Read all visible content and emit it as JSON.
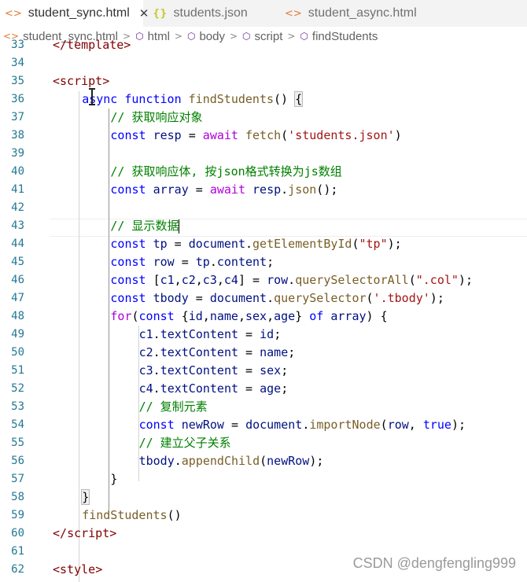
{
  "tabs": [
    {
      "icon": "html-file-icon",
      "label": "student_sync.html",
      "active": true,
      "close": "✕"
    },
    {
      "icon": "json-file-icon",
      "label": "students.json",
      "active": false
    },
    {
      "icon": "html-file-icon",
      "label": "student_async.html",
      "active": false
    }
  ],
  "breadcrumb": [
    "student_sync.html",
    "html",
    "body",
    "script",
    "findStudents"
  ],
  "lines": [
    {
      "n": "33",
      "code": [
        [
          "t-tag",
          "</template>"
        ]
      ]
    },
    {
      "n": "34",
      "code": []
    },
    {
      "n": "35",
      "code": [
        [
          "t-brk",
          "<"
        ],
        [
          "t-tag",
          "script"
        ],
        [
          "t-brk",
          ">"
        ]
      ]
    },
    {
      "n": "36",
      "code": [
        [
          "t-kw",
          "async"
        ],
        [
          "t-pun",
          " "
        ],
        [
          "t-kw",
          "function"
        ],
        [
          "t-pun",
          " "
        ],
        [
          "t-fn",
          "findStudents"
        ],
        [
          "t-pun",
          "() "
        ],
        [
          "bracket-hl",
          "{"
        ]
      ]
    },
    {
      "n": "37",
      "code": [
        [
          "t-cmt",
          "// 获取响应对象"
        ]
      ]
    },
    {
      "n": "38",
      "code": [
        [
          "t-kw",
          "const"
        ],
        [
          "t-pun",
          " "
        ],
        [
          "t-var",
          "resp"
        ],
        [
          "t-pun",
          " = "
        ],
        [
          "t-ctl",
          "await"
        ],
        [
          "t-pun",
          " "
        ],
        [
          "t-fn",
          "fetch"
        ],
        [
          "t-pun",
          "("
        ],
        [
          "t-str",
          "'students.json'"
        ],
        [
          "t-pun",
          ")"
        ]
      ]
    },
    {
      "n": "39",
      "code": []
    },
    {
      "n": "40",
      "code": [
        [
          "t-cmt",
          "// 获取响应体, 按json格式转换为js数组"
        ]
      ]
    },
    {
      "n": "41",
      "code": [
        [
          "t-kw",
          "const"
        ],
        [
          "t-pun",
          " "
        ],
        [
          "t-var",
          "array"
        ],
        [
          "t-pun",
          " = "
        ],
        [
          "t-ctl",
          "await"
        ],
        [
          "t-pun",
          " "
        ],
        [
          "t-var",
          "resp"
        ],
        [
          "t-pun",
          "."
        ],
        [
          "t-fn",
          "json"
        ],
        [
          "t-pun",
          "();"
        ]
      ]
    },
    {
      "n": "42",
      "code": []
    },
    {
      "n": "43",
      "code": [
        [
          "t-cmt",
          "// 显示数据"
        ]
      ]
    },
    {
      "n": "44",
      "code": [
        [
          "t-kw",
          "const"
        ],
        [
          "t-pun",
          " "
        ],
        [
          "t-var",
          "tp"
        ],
        [
          "t-pun",
          " = "
        ],
        [
          "t-var",
          "document"
        ],
        [
          "t-pun",
          "."
        ],
        [
          "t-fn",
          "getElementById"
        ],
        [
          "t-pun",
          "("
        ],
        [
          "t-str",
          "\"tp\""
        ],
        [
          "t-pun",
          ");"
        ]
      ]
    },
    {
      "n": "45",
      "code": [
        [
          "t-kw",
          "const"
        ],
        [
          "t-pun",
          " "
        ],
        [
          "t-var",
          "row"
        ],
        [
          "t-pun",
          " = "
        ],
        [
          "t-var",
          "tp"
        ],
        [
          "t-pun",
          "."
        ],
        [
          "t-var",
          "content"
        ],
        [
          "t-pun",
          ";"
        ]
      ]
    },
    {
      "n": "46",
      "code": [
        [
          "t-kw",
          "const"
        ],
        [
          "t-pun",
          " ["
        ],
        [
          "t-var",
          "c1"
        ],
        [
          "t-pun",
          ","
        ],
        [
          "t-var",
          "c2"
        ],
        [
          "t-pun",
          ","
        ],
        [
          "t-var",
          "c3"
        ],
        [
          "t-pun",
          ","
        ],
        [
          "t-var",
          "c4"
        ],
        [
          "t-pun",
          "] = "
        ],
        [
          "t-var",
          "row"
        ],
        [
          "t-pun",
          "."
        ],
        [
          "t-fn",
          "querySelectorAll"
        ],
        [
          "t-pun",
          "("
        ],
        [
          "t-str",
          "\".col\""
        ],
        [
          "t-pun",
          ");"
        ]
      ]
    },
    {
      "n": "47",
      "code": [
        [
          "t-kw",
          "const"
        ],
        [
          "t-pun",
          " "
        ],
        [
          "t-var",
          "tbody"
        ],
        [
          "t-pun",
          " = "
        ],
        [
          "t-var",
          "document"
        ],
        [
          "t-pun",
          "."
        ],
        [
          "t-fn",
          "querySelector"
        ],
        [
          "t-pun",
          "("
        ],
        [
          "t-str",
          "'.tbody'"
        ],
        [
          "t-pun",
          ");"
        ]
      ]
    },
    {
      "n": "48",
      "code": [
        [
          "t-ctl",
          "for"
        ],
        [
          "t-pun",
          "("
        ],
        [
          "t-kw",
          "const"
        ],
        [
          "t-pun",
          " {"
        ],
        [
          "t-var",
          "id"
        ],
        [
          "t-pun",
          ","
        ],
        [
          "t-var",
          "name"
        ],
        [
          "t-pun",
          ","
        ],
        [
          "t-var",
          "sex"
        ],
        [
          "t-pun",
          ","
        ],
        [
          "t-var",
          "age"
        ],
        [
          "t-pun",
          "} "
        ],
        [
          "t-kw",
          "of"
        ],
        [
          "t-pun",
          " "
        ],
        [
          "t-var",
          "array"
        ],
        [
          "t-pun",
          ") {"
        ]
      ]
    },
    {
      "n": "49",
      "code": [
        [
          "t-var",
          "c1"
        ],
        [
          "t-pun",
          "."
        ],
        [
          "t-var",
          "textContent"
        ],
        [
          "t-pun",
          " = "
        ],
        [
          "t-var",
          "id"
        ],
        [
          "t-pun",
          ";"
        ]
      ]
    },
    {
      "n": "50",
      "code": [
        [
          "t-var",
          "c2"
        ],
        [
          "t-pun",
          "."
        ],
        [
          "t-var",
          "textContent"
        ],
        [
          "t-pun",
          " = "
        ],
        [
          "t-var",
          "name"
        ],
        [
          "t-pun",
          ";"
        ]
      ]
    },
    {
      "n": "51",
      "code": [
        [
          "t-var",
          "c3"
        ],
        [
          "t-pun",
          "."
        ],
        [
          "t-var",
          "textContent"
        ],
        [
          "t-pun",
          " = "
        ],
        [
          "t-var",
          "sex"
        ],
        [
          "t-pun",
          ";"
        ]
      ]
    },
    {
      "n": "52",
      "code": [
        [
          "t-var",
          "c4"
        ],
        [
          "t-pun",
          "."
        ],
        [
          "t-var",
          "textContent"
        ],
        [
          "t-pun",
          " = "
        ],
        [
          "t-var",
          "age"
        ],
        [
          "t-pun",
          ";"
        ]
      ]
    },
    {
      "n": "53",
      "code": [
        [
          "t-cmt",
          "// 复制元素"
        ]
      ]
    },
    {
      "n": "54",
      "code": [
        [
          "t-kw",
          "const"
        ],
        [
          "t-pun",
          " "
        ],
        [
          "t-var",
          "newRow"
        ],
        [
          "t-pun",
          " = "
        ],
        [
          "t-var",
          "document"
        ],
        [
          "t-pun",
          "."
        ],
        [
          "t-fn",
          "importNode"
        ],
        [
          "t-pun",
          "("
        ],
        [
          "t-var",
          "row"
        ],
        [
          "t-pun",
          ", "
        ],
        [
          "t-kw",
          "true"
        ],
        [
          "t-pun",
          ");"
        ]
      ]
    },
    {
      "n": "55",
      "code": [
        [
          "t-cmt",
          "// 建立父子关系"
        ]
      ]
    },
    {
      "n": "56",
      "code": [
        [
          "t-var",
          "tbody"
        ],
        [
          "t-pun",
          "."
        ],
        [
          "t-fn",
          "appendChild"
        ],
        [
          "t-pun",
          "("
        ],
        [
          "t-var",
          "newRow"
        ],
        [
          "t-pun",
          ");"
        ]
      ]
    },
    {
      "n": "57",
      "code": [
        [
          "t-pun",
          "}"
        ]
      ]
    },
    {
      "n": "58",
      "code": [
        [
          "bracket-hl",
          "}"
        ]
      ]
    },
    {
      "n": "59",
      "code": [
        [
          "t-fn",
          "findStudents"
        ],
        [
          "t-pun",
          "()"
        ]
      ]
    },
    {
      "n": "60",
      "code": [
        [
          "t-brk",
          "</"
        ],
        [
          "t-tag",
          "script"
        ],
        [
          "t-brk",
          ">"
        ]
      ]
    },
    {
      "n": "61",
      "code": []
    },
    {
      "n": "62",
      "code": [
        [
          "t-brk",
          "<"
        ],
        [
          "t-tag",
          "style"
        ],
        [
          "t-brk",
          ">"
        ]
      ]
    }
  ],
  "watermark": "CSDN @dengfengling999"
}
